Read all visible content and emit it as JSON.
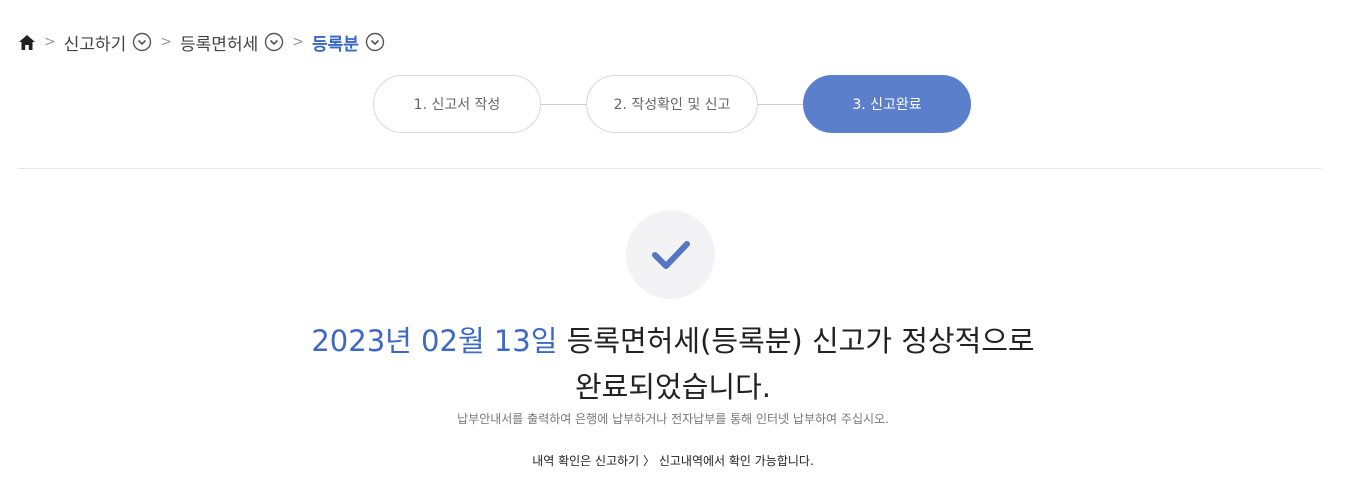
{
  "breadcrumb": {
    "items": [
      {
        "label": "신고하기"
      },
      {
        "label": "등록면허세"
      },
      {
        "label": "등록분"
      }
    ]
  },
  "steps": [
    {
      "label": "1. 신고서 작성"
    },
    {
      "label": "2. 작성확인 및 신고"
    },
    {
      "label": "3. 신고완료"
    }
  ],
  "result": {
    "date": "2023년 02월 13일",
    "title_rest": " 등록면허세(등록분) 신고가 정상적으로",
    "title_line2": "완료되었습니다.",
    "note1": "납부안내서를 출력하여 은행에 납부하거나 전자납부를 통해 인터넷 납부하여 주십시오.",
    "note2": "내역 확인은 신고하기 〉 신고내역에서 확인 가능합니다."
  },
  "colors": {
    "accent": "#5b7fcb",
    "date_text": "#3e68c6",
    "active_crumb": "#3a66c4"
  }
}
